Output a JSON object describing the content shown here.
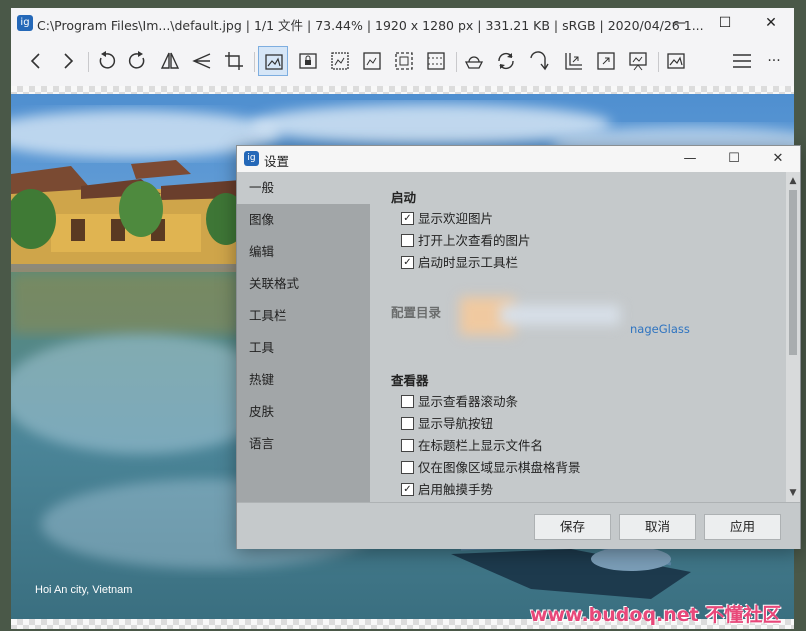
{
  "window": {
    "title": "C:\\Program Files\\Im...\\default.jpg  |  1/1 文件  |  73.44%  |  1920 x 1280 px  |  331.21 KB  |  sRGB  |  2020/04/26 1...",
    "app_icon_glyph": "ig",
    "minimize_glyph": "—",
    "maximize_glyph": "☐",
    "close_glyph": "✕"
  },
  "toolbar": {
    "icons": [
      "prev-image-icon",
      "next-image-icon",
      "rotate-left-icon",
      "rotate-right-icon",
      "flip-horizontal-icon",
      "flip-vertical-icon",
      "crop-icon",
      "auto-zoom-icon",
      "lock-zoom-icon",
      "scale-to-width-icon",
      "scale-to-height-icon",
      "scale-to-fit-icon",
      "scale-to-fill-icon",
      "open-with-icon",
      "refresh-icon",
      "goto-image-icon",
      "frameless-icon",
      "fullscreen-icon",
      "slideshow-icon",
      "set-wallpaper-icon",
      "menu-icon",
      "more-icon"
    ],
    "active_icon": "auto-zoom-icon",
    "more_glyph": "···"
  },
  "viewer": {
    "caption": "Hoi An city, Vietnam"
  },
  "watermark": "www.budoq.net 不懂社区",
  "dialog": {
    "title": "设置",
    "icon_glyph": "ig",
    "minimize_glyph": "—",
    "maximize_glyph": "☐",
    "close_glyph": "✕",
    "nav": [
      "一般",
      "图像",
      "编辑",
      "关联格式",
      "工具栏",
      "工具",
      "热键",
      "皮肤",
      "语言"
    ],
    "selected_nav": "一般",
    "sections": {
      "startup": {
        "title": "启动",
        "items": [
          {
            "label": "显示欢迎图片",
            "checked": true
          },
          {
            "label": "打开上次查看的图片",
            "checked": false
          },
          {
            "label": "启动时显示工具栏",
            "checked": true
          }
        ]
      },
      "config": {
        "title": "配置目录",
        "path_visible": "nageGlass"
      },
      "viewer": {
        "title": "查看器",
        "items": [
          {
            "label": "显示查看器滚动条",
            "checked": false
          },
          {
            "label": "显示导航按钮",
            "checked": false
          },
          {
            "label": "在标题栏上显示文件名",
            "checked": false
          },
          {
            "label": "仅在图像区域显示棋盘格背景",
            "checked": false
          },
          {
            "label": "启用触摸手势",
            "checked": true
          }
        ]
      }
    },
    "buttons": {
      "save": "保存",
      "cancel": "取消",
      "apply": "应用"
    },
    "check_glyph": "✓",
    "scroll_up_glyph": "▲",
    "scroll_down_glyph": "▼"
  },
  "colors": {
    "accent": "#2468b8",
    "link": "#2f74c0",
    "toolbar_active": "#d6e6f7",
    "watermark": "#e8487a"
  }
}
